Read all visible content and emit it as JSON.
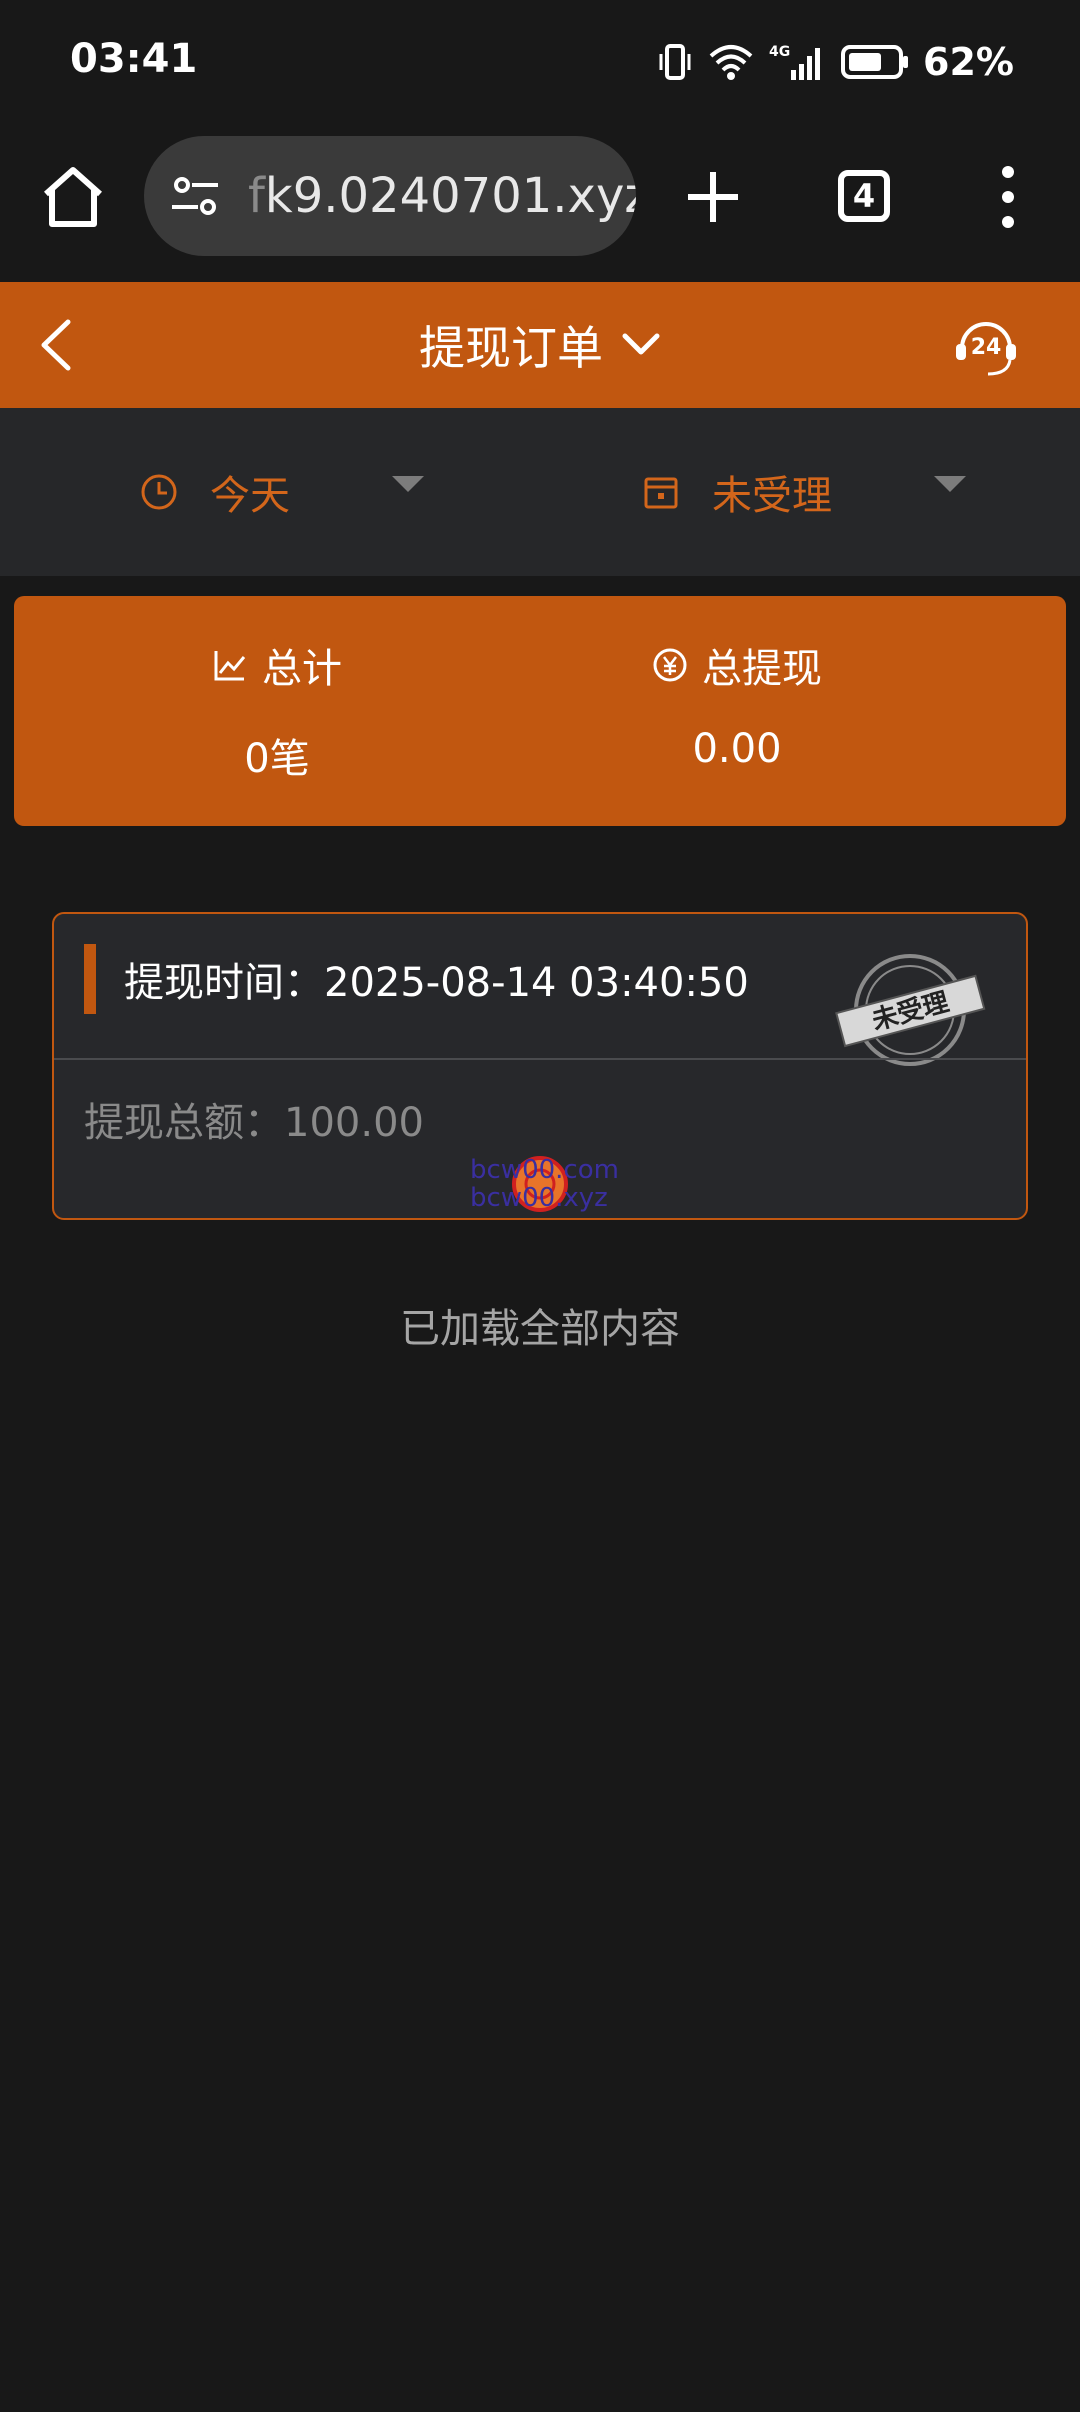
{
  "status_bar": {
    "time": "03:41",
    "network": "4G",
    "battery_percent": "62%"
  },
  "browser": {
    "url_prefix": "f",
    "url_main": "k9.0240701.xyz",
    "tab_count": "4"
  },
  "header": {
    "title": "提现订单"
  },
  "support": {
    "label": "24"
  },
  "filters": {
    "date_label": "今天",
    "status_label": "未受理"
  },
  "summary": {
    "total_label": "总计",
    "total_value": "0笔",
    "withdraw_label": "总提现",
    "withdraw_value": "0.00"
  },
  "order": {
    "time_label": "提现时间：",
    "time_value": "2025-08-14 03:40:50",
    "amount_label": "提现总额：",
    "amount_value": "100.00",
    "stamp_text": "未受理"
  },
  "watermark": {
    "line1": "bcw00.com",
    "line2": "bcw00.xyz"
  },
  "footer": {
    "loaded_text": "已加载全部内容"
  },
  "colors": {
    "accent": "#c15710",
    "accent_text": "#d3661b",
    "background": "#181818",
    "card": "#27282b"
  }
}
